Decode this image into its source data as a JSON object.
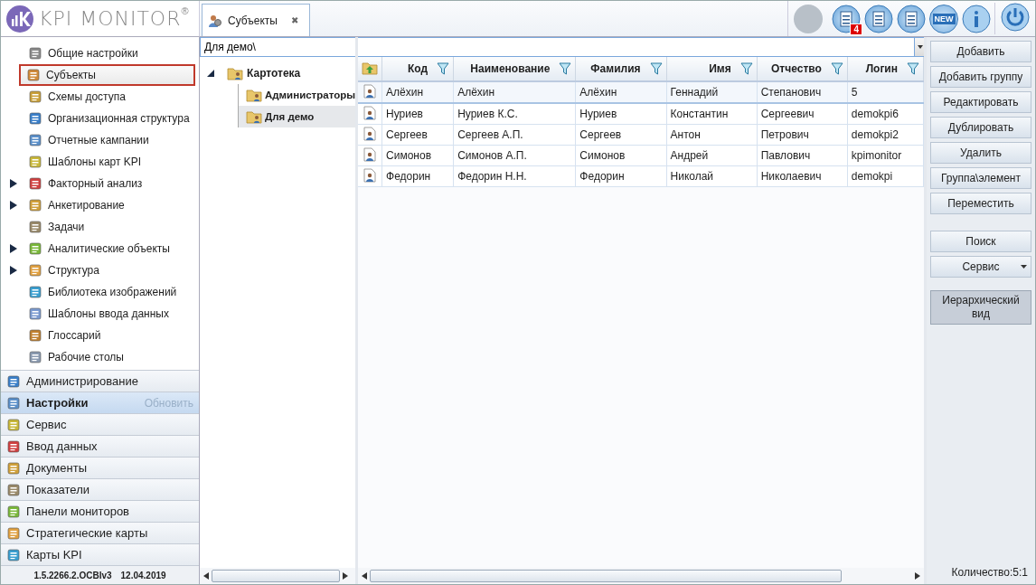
{
  "logo": {
    "text": "KPI MONITOR",
    "mark": "®"
  },
  "tabs": [
    {
      "label": "Субъекты",
      "close": "✖",
      "selected": true
    }
  ],
  "toolbar": {
    "badge": "4",
    "new_label": "NEW"
  },
  "nav": {
    "items": [
      {
        "label": "Общие настройки",
        "expandable": false,
        "selected": false
      },
      {
        "label": "Субъекты",
        "expandable": false,
        "selected": true
      },
      {
        "label": "Схемы доступа",
        "expandable": false,
        "selected": false
      },
      {
        "label": "Организационная структура",
        "expandable": false,
        "selected": false
      },
      {
        "label": "Отчетные кампании",
        "expandable": false,
        "selected": false
      },
      {
        "label": "Шаблоны карт KPI",
        "expandable": false,
        "selected": false
      },
      {
        "label": "Факторный анализ",
        "expandable": true,
        "selected": false
      },
      {
        "label": "Анкетирование",
        "expandable": true,
        "selected": false
      },
      {
        "label": "Задачи",
        "expandable": false,
        "selected": false
      },
      {
        "label": "Аналитические объекты",
        "expandable": true,
        "selected": false
      },
      {
        "label": "Структура",
        "expandable": true,
        "selected": false
      },
      {
        "label": "Библиотека изображений",
        "expandable": false,
        "selected": false
      },
      {
        "label": "Шаблоны ввода данных",
        "expandable": false,
        "selected": false
      },
      {
        "label": "Глоссарий",
        "expandable": false,
        "selected": false
      },
      {
        "label": "Рабочие столы",
        "expandable": false,
        "selected": false
      }
    ],
    "sections": [
      {
        "label": "Администрирование",
        "selected": false
      },
      {
        "label": "Настройки",
        "selected": true,
        "action": "Обновить"
      },
      {
        "label": "Сервис",
        "selected": false
      },
      {
        "label": "Ввод данных",
        "selected": false
      },
      {
        "label": "Документы",
        "selected": false
      },
      {
        "label": "Показатели",
        "selected": false
      },
      {
        "label": "Панели мониторов",
        "selected": false
      },
      {
        "label": "Стратегические карты",
        "selected": false
      },
      {
        "label": "Карты KPI",
        "selected": false
      }
    ],
    "version": "1.5.2266.2.OCBIv3",
    "date": "12.04.2019"
  },
  "path_field": {
    "value": "Для демо\\"
  },
  "tree": [
    {
      "label": "Картотека",
      "expanded": true,
      "selected": false,
      "children": [
        {
          "label": "Администраторы",
          "selected": false
        },
        {
          "label": "Для демо",
          "selected": true
        }
      ]
    }
  ],
  "table": {
    "columns": [
      "Код",
      "Наименование",
      "Фамилия",
      "Имя",
      "Отчество",
      "Логин"
    ],
    "rows": [
      {
        "cells": [
          "Алёхин",
          "Алёхин",
          "Алёхин",
          "Геннадий",
          "Степанович",
          "5"
        ],
        "selected": true
      },
      {
        "cells": [
          "Нуриев",
          "Нуриев К.С.",
          "Нуриев",
          "Константин",
          "Сергеевич",
          "demokpi6"
        ],
        "selected": false
      },
      {
        "cells": [
          "Сергеев",
          "Сергеев А.П.",
          "Сергеев",
          "Антон",
          "Петрович",
          "demokpi2"
        ],
        "selected": false
      },
      {
        "cells": [
          "Симонов",
          "Симонов А.П.",
          "Симонов",
          "Андрей",
          "Павлович",
          "kpimonitor"
        ],
        "selected": false
      },
      {
        "cells": [
          "Федорин",
          "Федорин Н.Н.",
          "Федорин",
          "Николай",
          "Николаевич",
          "demokpi"
        ],
        "selected": false
      }
    ]
  },
  "actions": [
    {
      "label": "Добавить",
      "kind": "button"
    },
    {
      "label": "Добавить группу",
      "kind": "button"
    },
    {
      "label": "Редактировать",
      "kind": "button"
    },
    {
      "label": "Дублировать",
      "kind": "button"
    },
    {
      "label": "Удалить",
      "kind": "button"
    },
    {
      "label": "Группа\\элемент",
      "kind": "button"
    },
    {
      "label": "Переместить",
      "kind": "button"
    },
    {
      "label": "Поиск",
      "kind": "gap-button"
    },
    {
      "label": "Сервис",
      "kind": "dropdown"
    },
    {
      "label": "Иерархический вид",
      "kind": "toggle",
      "on": true
    }
  ],
  "status": "Количество:5:1"
}
